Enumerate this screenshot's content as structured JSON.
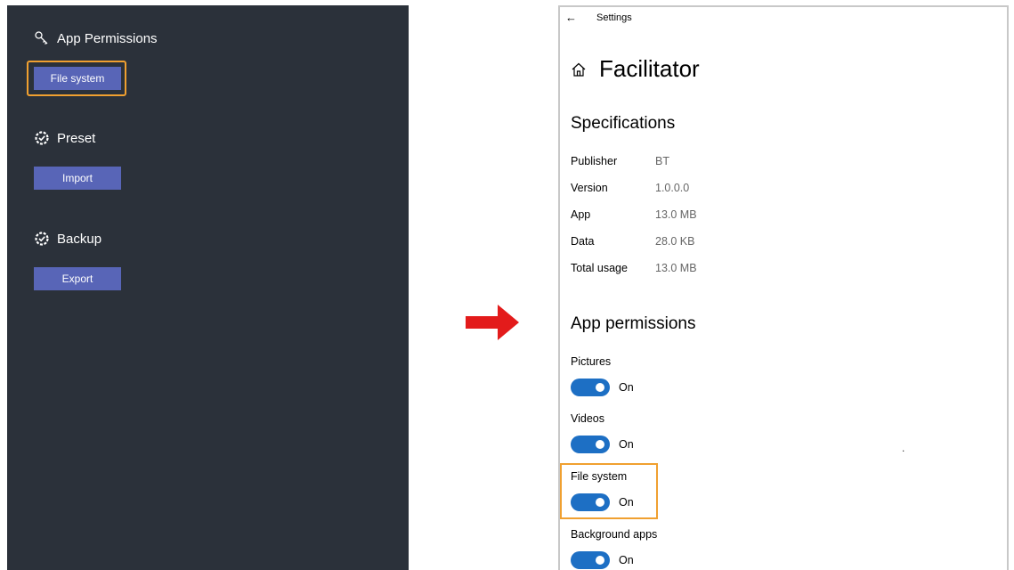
{
  "left_panel": {
    "app_permissions": {
      "heading": "App Permissions",
      "icon": "key-icon",
      "button_label": "File system"
    },
    "preset": {
      "heading": "Preset",
      "icon": "gear-check-icon",
      "button_label": "Import"
    },
    "backup": {
      "heading": "Backup",
      "icon": "gear-check-icon",
      "button_label": "Export"
    }
  },
  "arrow": {
    "color": "#e31b1b"
  },
  "settings": {
    "window_title": "Settings",
    "app_name": "Facilitator",
    "specifications": {
      "heading": "Specifications",
      "rows": [
        {
          "key": "Publisher",
          "value": "BT"
        },
        {
          "key": "Version",
          "value": "1.0.0.0"
        },
        {
          "key": "App",
          "value": "13.0 MB"
        },
        {
          "key": "Data",
          "value": "28.0 KB"
        },
        {
          "key": "Total usage",
          "value": "13.0 MB"
        }
      ]
    },
    "permissions": {
      "heading": "App permissions",
      "items": [
        {
          "label": "Pictures",
          "state": "On"
        },
        {
          "label": "Videos",
          "state": "On"
        },
        {
          "label": "File system",
          "state": "On"
        },
        {
          "label": "Background apps",
          "state": "On"
        }
      ]
    },
    "stray_dot": "."
  },
  "colors": {
    "panel_bg": "#2b313a",
    "button": "#5865b7",
    "highlight": "#f0a030",
    "toggle_on": "#1d6fc4"
  }
}
